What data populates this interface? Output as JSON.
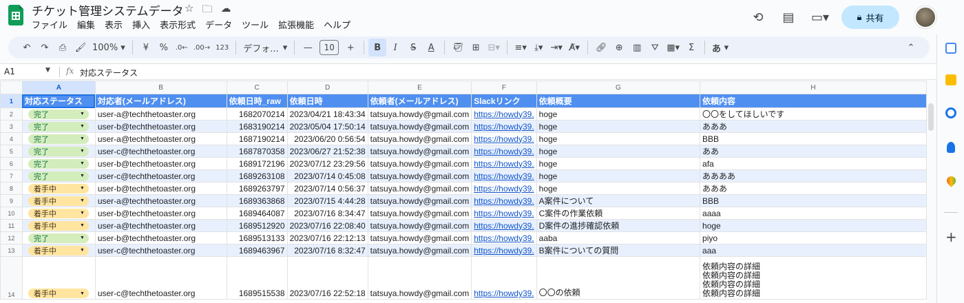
{
  "app": {
    "title": "チケット管理システムデータ",
    "share_label": "共有",
    "share_icon": "lock-icon"
  },
  "menu": [
    "ファイル",
    "編集",
    "表示",
    "挿入",
    "表示形式",
    "データ",
    "ツール",
    "拡張機能",
    "ヘルプ"
  ],
  "toolbar": {
    "zoom": "100%",
    "currency": "¥",
    "percent": "%",
    "dec_decrease": ".0←",
    "dec_increase": ".00→",
    "number_format": "123",
    "font": "デフォ...",
    "minus": "—",
    "font_size": "10",
    "plus": "+",
    "bold": "B",
    "italic": "I",
    "strike": "S",
    "text_color": "A",
    "input_tools": "あ"
  },
  "formula_bar": {
    "cell_ref": "A1",
    "fx": "fx",
    "value": "対応ステータス"
  },
  "columns": [
    "A",
    "B",
    "C",
    "D",
    "E",
    "F",
    "G",
    "H"
  ],
  "header_row": [
    "対応ステータス",
    "対応者(メールアドレス)",
    "依頼日時_raw",
    "依頼日時",
    "依頼者(メールアドレス)",
    "Slackリンク",
    "依頼概要",
    "依頼内容"
  ],
  "rows": [
    {
      "n": "2",
      "status": "完了",
      "kind": "done",
      "assignee": "user-a@techthetoaster.org",
      "raw": "1682070214",
      "date": "2023/04/21 18:43:34",
      "requester": "tatsuya.howdy@gmail.com",
      "link": "https://howdy39.",
      "summary": "hoge",
      "detail": "〇〇をしてほしいです"
    },
    {
      "n": "3",
      "status": "完了",
      "kind": "done",
      "assignee": "user-b@techthetoaster.org",
      "raw": "1683190214",
      "date": "2023/05/04 17:50:14",
      "requester": "tatsuya.howdy@gmail.com",
      "link": "https://howdy39.",
      "summary": "hoge",
      "detail": "あああ"
    },
    {
      "n": "4",
      "status": "完了",
      "kind": "done",
      "assignee": "user-a@techthetoaster.org",
      "raw": "1687190214",
      "date": "2023/06/20 0:56:54",
      "requester": "tatsuya.howdy@gmail.com",
      "link": "https://howdy39.",
      "summary": "hoge",
      "detail": "BBB"
    },
    {
      "n": "5",
      "status": "完了",
      "kind": "done",
      "assignee": "user-c@techthetoaster.org",
      "raw": "1687870358",
      "date": "2023/06/27 21:52:38",
      "requester": "tatsuya.howdy@gmail.com",
      "link": "https://howdy39.",
      "summary": "hoge",
      "detail": "ああ"
    },
    {
      "n": "6",
      "status": "完了",
      "kind": "done",
      "assignee": "user-b@techthetoaster.org",
      "raw": "1689172196",
      "date": "2023/07/12 23:29:56",
      "requester": "tatsuya.howdy@gmail.com",
      "link": "https://howdy39.",
      "summary": "hoge",
      "detail": "afa"
    },
    {
      "n": "7",
      "status": "完了",
      "kind": "done",
      "assignee": "user-c@techthetoaster.org",
      "raw": "1689263108",
      "date": "2023/07/14 0:45:08",
      "requester": "tatsuya.howdy@gmail.com",
      "link": "https://howdy39.",
      "summary": "hoge",
      "detail": "ああああ"
    },
    {
      "n": "8",
      "status": "着手中",
      "kind": "doing",
      "assignee": "user-b@techthetoaster.org",
      "raw": "1689263797",
      "date": "2023/07/14 0:56:37",
      "requester": "tatsuya.howdy@gmail.com",
      "link": "https://howdy39.",
      "summary": "hoge",
      "detail": "あああ"
    },
    {
      "n": "9",
      "status": "着手中",
      "kind": "doing",
      "assignee": "user-a@techthetoaster.org",
      "raw": "1689363868",
      "date": "2023/07/15 4:44:28",
      "requester": "tatsuya.howdy@gmail.com",
      "link": "https://howdy39.",
      "summary": "A案件について",
      "detail": "BBB"
    },
    {
      "n": "10",
      "status": "着手中",
      "kind": "doing",
      "assignee": "user-b@techthetoaster.org",
      "raw": "1689464087",
      "date": "2023/07/16 8:34:47",
      "requester": "tatsuya.howdy@gmail.com",
      "link": "https://howdy39.",
      "summary": "C案件の作業依頼",
      "detail": "aaaa"
    },
    {
      "n": "11",
      "status": "着手中",
      "kind": "doing",
      "assignee": "user-a@techthetoaster.org",
      "raw": "1689512920",
      "date": "2023/07/16 22:08:40",
      "requester": "tatsuya.howdy@gmail.com",
      "link": "https://howdy39.",
      "summary": "D案件の進捗確認依頼",
      "detail": "hoge"
    },
    {
      "n": "12",
      "status": "完了",
      "kind": "done",
      "assignee": "user-b@techthetoaster.org",
      "raw": "1689513133",
      "date": "2023/07/16 22:12:13",
      "requester": "tatsuya.howdy@gmail.com",
      "link": "https://howdy39.",
      "summary": "aaba",
      "detail": "piyo"
    },
    {
      "n": "13",
      "status": "着手中",
      "kind": "doing",
      "assignee": "user-c@techthetoaster.org",
      "raw": "1689463967",
      "date": "2023/07/16 8:32:47",
      "requester": "tatsuya.howdy@gmail.com",
      "link": "https://howdy39.",
      "summary": "B案件についての質問",
      "detail": "aaa"
    },
    {
      "n": "14",
      "status": "着手中",
      "kind": "doing",
      "assignee": "user-c@techthetoaster.org",
      "raw": "1689515538",
      "date": "2023/07/16 22:52:18",
      "requester": "tatsuya.howdy@gmail.com",
      "link": "https://howdy39.",
      "summary": "〇〇の依頼",
      "detail": "依頼内容の詳細\n依頼内容の詳細\n依頼内容の詳細\n依頼内容の詳細"
    }
  ],
  "colors": {
    "header_fill": "#4f8ff0",
    "band_fill": "#e8f0fe",
    "chip_done": "#d4edbc",
    "chip_doing": "#ffe5a0",
    "share_fill": "#c2e7ff"
  }
}
